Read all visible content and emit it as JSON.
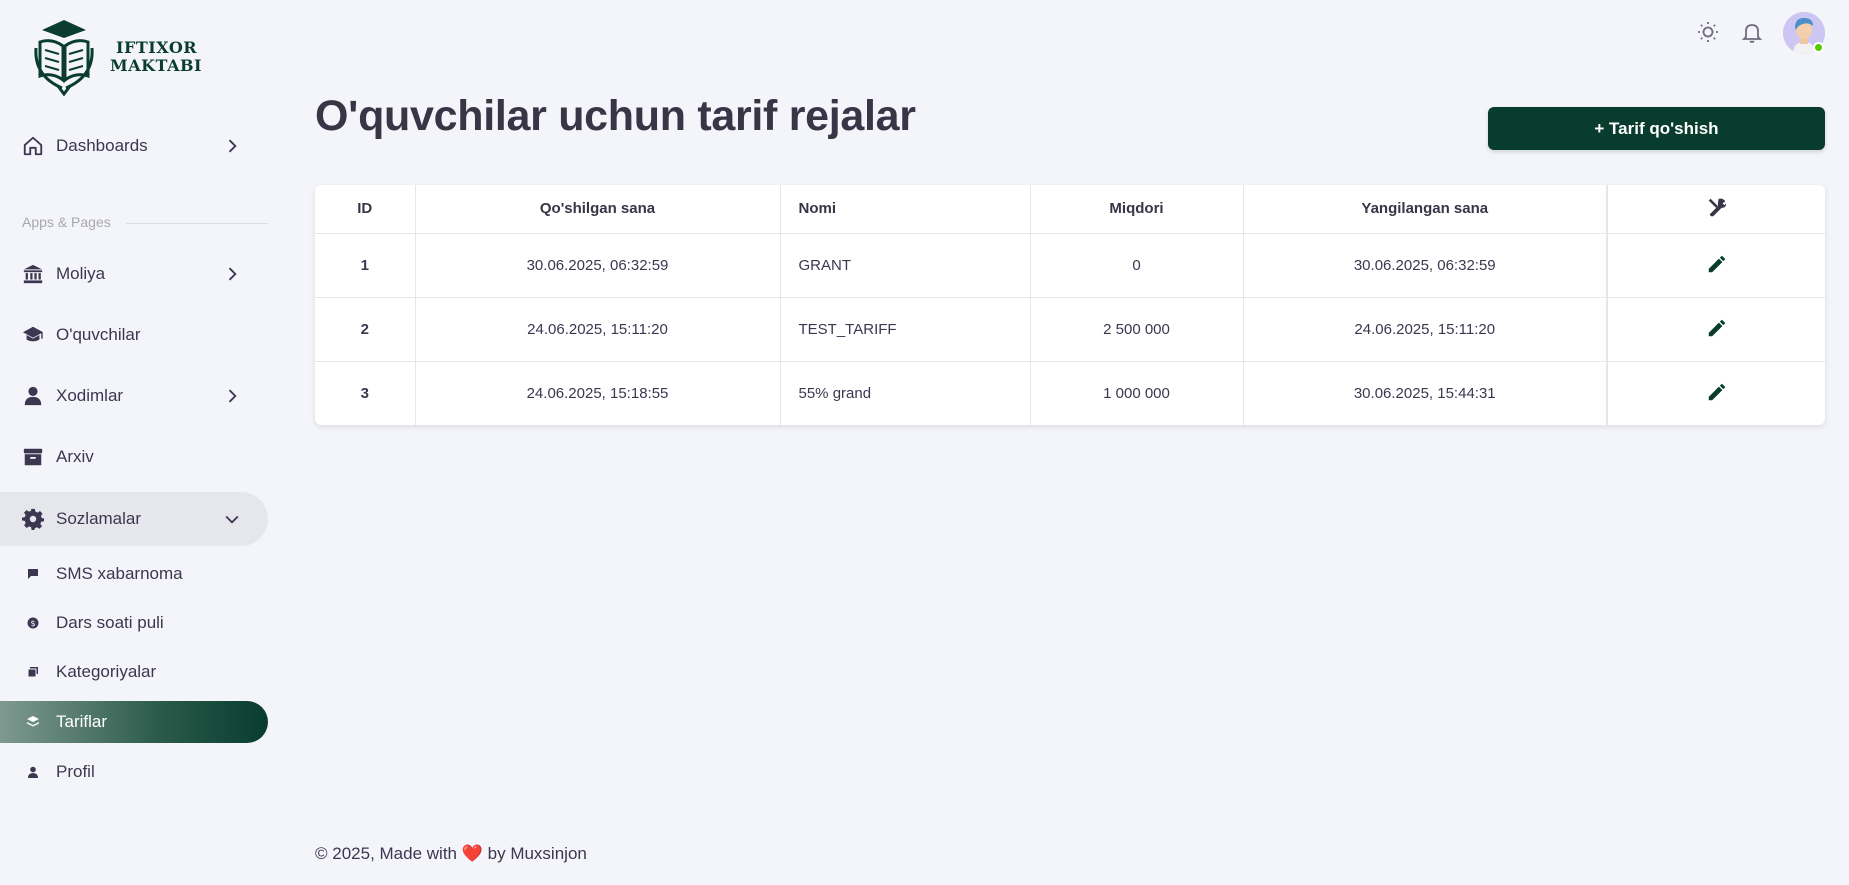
{
  "brand": {
    "line1": "IFTIXOR",
    "line2": "MAKTABI"
  },
  "nav": {
    "dashboards": "Dashboards",
    "section_label": "Apps & Pages",
    "moliya": "Moliya",
    "oquvchilar": "O'quvchilar",
    "xodimlar": "Xodimlar",
    "arxiv": "Arxiv",
    "sozlamalar": "Sozlamalar",
    "sub": {
      "sms": "SMS xabarnoma",
      "dars": "Dars soati puli",
      "kategoriyalar": "Kategoriyalar",
      "tariflar": "Tariflar",
      "profil": "Profil"
    }
  },
  "page": {
    "title": "O'quvchilar uchun tarif rejalar",
    "add_button": "+ Tarif qo'shish"
  },
  "table": {
    "headers": {
      "id": "ID",
      "added": "Qo'shilgan sana",
      "name": "Nomi",
      "amount": "Miqdori",
      "updated": "Yangilangan sana"
    },
    "rows": [
      {
        "id": "1",
        "added": "30.06.2025, 06:32:59",
        "name": "GRANT",
        "amount": "0",
        "updated": "30.06.2025, 06:32:59"
      },
      {
        "id": "2",
        "added": "24.06.2025, 15:11:20",
        "name": "TEST_TARIFF",
        "amount": "2 500 000",
        "updated": "24.06.2025, 15:11:20"
      },
      {
        "id": "3",
        "added": "24.06.2025, 15:18:55",
        "name": "55% grand",
        "amount": "1 000 000",
        "updated": "30.06.2025, 15:44:31"
      }
    ]
  },
  "footer": {
    "prefix": "© 2025, Made with",
    "suffix": "by Muxsinjon"
  },
  "colors": {
    "primary": "#083d2e",
    "background": "#f4f5fa",
    "text": "#3d3650",
    "online": "#56ca00"
  }
}
